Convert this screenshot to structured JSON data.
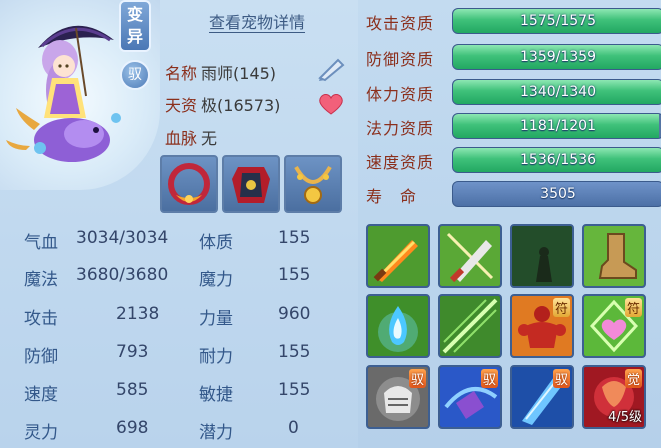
{
  "portrait": {
    "pill_top": "变",
    "pill_bottom": "异",
    "badge": "驭"
  },
  "detail_link": "查看宠物详情",
  "info": {
    "name_label": "名称",
    "name_value": "雨师(145)",
    "aptitude_label": "天资",
    "aptitude_value": "极(16573)",
    "bloodline_label": "血脉",
    "bloodline_value": "无"
  },
  "stats": [
    {
      "label": "气血",
      "value": "3034/3034",
      "label2": "体质",
      "value2": "155"
    },
    {
      "label": "魔法",
      "value": "3680/3680",
      "label2": "魔力",
      "value2": "155"
    },
    {
      "label": "攻击",
      "value": "2138",
      "label2": "力量",
      "value2": "960"
    },
    {
      "label": "防御",
      "value": "793",
      "label2": "耐力",
      "value2": "155"
    },
    {
      "label": "速度",
      "value": "585",
      "label2": "敏捷",
      "value2": "155"
    },
    {
      "label": "灵力",
      "value": "698",
      "label2": "潜力",
      "value2": "0"
    }
  ],
  "aptitudes": [
    {
      "label": "攻击资质",
      "text": "1575/1575",
      "fill": 1.0
    },
    {
      "label": "防御资质",
      "text": "1359/1359",
      "fill": 1.0
    },
    {
      "label": "体力资质",
      "text": "1340/1340",
      "fill": 1.0
    },
    {
      "label": "法力资质",
      "text": "1181/1201",
      "fill": 0.983
    },
    {
      "label": "速度资质",
      "text": "1536/1536",
      "fill": 1.0
    },
    {
      "label": "寿　命",
      "text": "3505",
      "fill": 0
    }
  ],
  "skills": {
    "tag_yu": "驭",
    "tag_fu": "符",
    "tag_jue": "觉",
    "awaken_level": "4/5级"
  },
  "colors": {
    "accent_red": "#8b2f1c",
    "bar_green": "#3fc17a",
    "panel_bg": "#c3dbf0"
  }
}
